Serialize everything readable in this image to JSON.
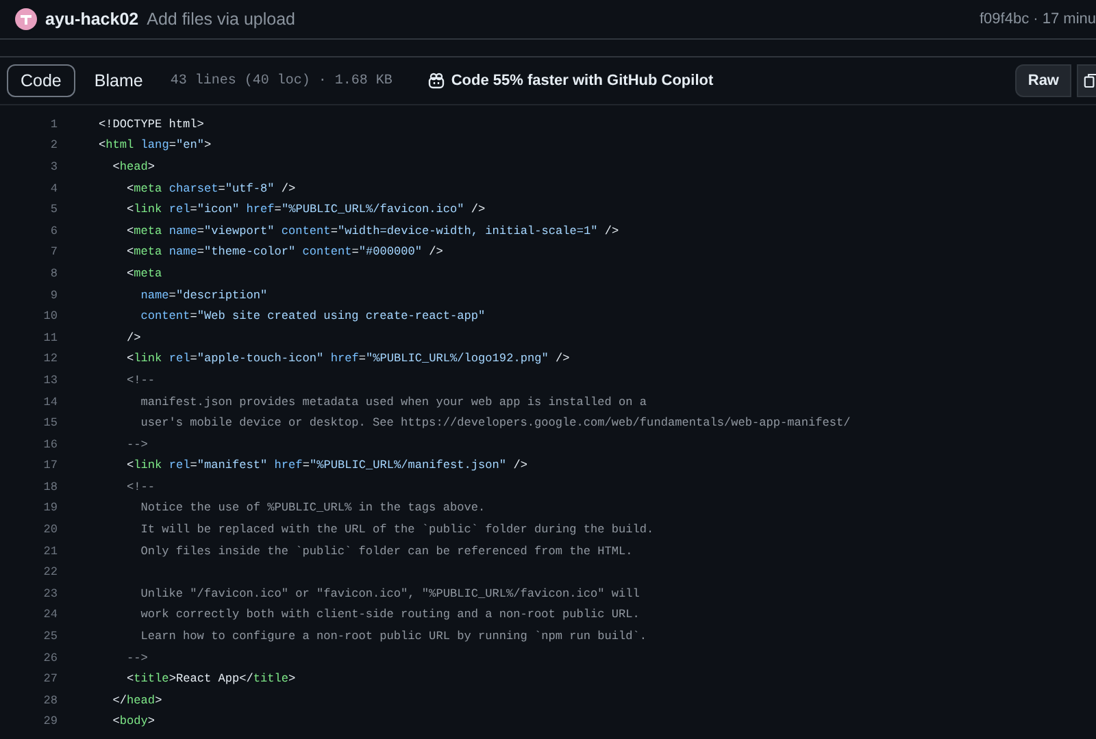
{
  "commit": {
    "author": "ayu-hack02",
    "message": "Add files via upload",
    "meta": "f09f4bc · 17 minu"
  },
  "toolbar": {
    "tabs": [
      {
        "label": "Code",
        "selected": true
      },
      {
        "label": "Blame",
        "selected": false
      }
    ],
    "file_info": "43 lines (40 loc) · 1.68 KB",
    "copilot": "Code 55% faster with GitHub Copilot",
    "raw": "Raw"
  },
  "lines": [
    {
      "number": "1",
      "tokens": [
        {
          "kind": "punct",
          "text": "<!DOCTYPE html>"
        }
      ]
    },
    {
      "number": "2",
      "tokens": [
        {
          "kind": "punct",
          "text": "<"
        },
        {
          "kind": "tag",
          "text": "html"
        },
        {
          "kind": "attr",
          "text": " lang"
        },
        {
          "kind": "punct",
          "text": "="
        },
        {
          "kind": "string",
          "text": "\"en\""
        },
        {
          "kind": "punct",
          "text": ">"
        }
      ]
    },
    {
      "number": "3",
      "tokens": [
        {
          "kind": "punct",
          "text": "  <"
        },
        {
          "kind": "tag",
          "text": "head"
        },
        {
          "kind": "punct",
          "text": ">"
        }
      ]
    },
    {
      "number": "4",
      "tokens": [
        {
          "kind": "punct",
          "text": "    <"
        },
        {
          "kind": "tag",
          "text": "meta"
        },
        {
          "kind": "attr",
          "text": " charset"
        },
        {
          "kind": "punct",
          "text": "="
        },
        {
          "kind": "string",
          "text": "\"utf-8\""
        },
        {
          "kind": "punct",
          "text": " />"
        }
      ]
    },
    {
      "number": "5",
      "tokens": [
        {
          "kind": "punct",
          "text": "    <"
        },
        {
          "kind": "tag",
          "text": "link"
        },
        {
          "kind": "attr",
          "text": " rel"
        },
        {
          "kind": "punct",
          "text": "="
        },
        {
          "kind": "string",
          "text": "\"icon\""
        },
        {
          "kind": "attr",
          "text": " href"
        },
        {
          "kind": "punct",
          "text": "="
        },
        {
          "kind": "string",
          "text": "\"%PUBLIC_URL%/favicon.ico\""
        },
        {
          "kind": "punct",
          "text": " />"
        }
      ]
    },
    {
      "number": "6",
      "tokens": [
        {
          "kind": "punct",
          "text": "    <"
        },
        {
          "kind": "tag",
          "text": "meta"
        },
        {
          "kind": "attr",
          "text": " name"
        },
        {
          "kind": "punct",
          "text": "="
        },
        {
          "kind": "string",
          "text": "\"viewport\""
        },
        {
          "kind": "attr",
          "text": " content"
        },
        {
          "kind": "punct",
          "text": "="
        },
        {
          "kind": "string",
          "text": "\"width=device-width, initial-scale=1\""
        },
        {
          "kind": "punct",
          "text": " />"
        }
      ]
    },
    {
      "number": "7",
      "tokens": [
        {
          "kind": "punct",
          "text": "    <"
        },
        {
          "kind": "tag",
          "text": "meta"
        },
        {
          "kind": "attr",
          "text": " name"
        },
        {
          "kind": "punct",
          "text": "="
        },
        {
          "kind": "string",
          "text": "\"theme-color\""
        },
        {
          "kind": "attr",
          "text": " content"
        },
        {
          "kind": "punct",
          "text": "="
        },
        {
          "kind": "string",
          "text": "\"#000000\""
        },
        {
          "kind": "punct",
          "text": " />"
        }
      ]
    },
    {
      "number": "8",
      "tokens": [
        {
          "kind": "punct",
          "text": "    <"
        },
        {
          "kind": "tag",
          "text": "meta"
        }
      ]
    },
    {
      "number": "9",
      "tokens": [
        {
          "kind": "attr",
          "text": "      name"
        },
        {
          "kind": "punct",
          "text": "="
        },
        {
          "kind": "string",
          "text": "\"description\""
        }
      ]
    },
    {
      "number": "10",
      "tokens": [
        {
          "kind": "attr",
          "text": "      content"
        },
        {
          "kind": "punct",
          "text": "="
        },
        {
          "kind": "string",
          "text": "\"Web site created using create-react-app\""
        }
      ]
    },
    {
      "number": "11",
      "tokens": [
        {
          "kind": "punct",
          "text": "    />"
        }
      ]
    },
    {
      "number": "12",
      "tokens": [
        {
          "kind": "punct",
          "text": "    <"
        },
        {
          "kind": "tag",
          "text": "link"
        },
        {
          "kind": "attr",
          "text": " rel"
        },
        {
          "kind": "punct",
          "text": "="
        },
        {
          "kind": "string",
          "text": "\"apple-touch-icon\""
        },
        {
          "kind": "attr",
          "text": " href"
        },
        {
          "kind": "punct",
          "text": "="
        },
        {
          "kind": "string",
          "text": "\"%PUBLIC_URL%/logo192.png\""
        },
        {
          "kind": "punct",
          "text": " />"
        }
      ]
    },
    {
      "number": "13",
      "tokens": [
        {
          "kind": "comment",
          "text": "    <!--"
        }
      ]
    },
    {
      "number": "14",
      "tokens": [
        {
          "kind": "comment",
          "text": "      manifest.json provides metadata used when your web app is installed on a"
        }
      ]
    },
    {
      "number": "15",
      "tokens": [
        {
          "kind": "comment",
          "text": "      user's mobile device or desktop. See https://developers.google.com/web/fundamentals/web-app-manifest/"
        }
      ]
    },
    {
      "number": "16",
      "tokens": [
        {
          "kind": "comment",
          "text": "    -->"
        }
      ]
    },
    {
      "number": "17",
      "tokens": [
        {
          "kind": "punct",
          "text": "    <"
        },
        {
          "kind": "tag",
          "text": "link"
        },
        {
          "kind": "attr",
          "text": " rel"
        },
        {
          "kind": "punct",
          "text": "="
        },
        {
          "kind": "string",
          "text": "\"manifest\""
        },
        {
          "kind": "attr",
          "text": " href"
        },
        {
          "kind": "punct",
          "text": "="
        },
        {
          "kind": "string",
          "text": "\"%PUBLIC_URL%/manifest.json\""
        },
        {
          "kind": "punct",
          "text": " />"
        }
      ]
    },
    {
      "number": "18",
      "tokens": [
        {
          "kind": "comment",
          "text": "    <!--"
        }
      ]
    },
    {
      "number": "19",
      "tokens": [
        {
          "kind": "comment",
          "text": "      Notice the use of %PUBLIC_URL% in the tags above."
        }
      ]
    },
    {
      "number": "20",
      "tokens": [
        {
          "kind": "comment",
          "text": "      It will be replaced with the URL of the `public` folder during the build."
        }
      ]
    },
    {
      "number": "21",
      "tokens": [
        {
          "kind": "comment",
          "text": "      Only files inside the `public` folder can be referenced from the HTML."
        }
      ]
    },
    {
      "number": "22"
    },
    {
      "number": "23",
      "tokens": [
        {
          "kind": "comment",
          "text": "      Unlike \"/favicon.ico\" or \"favicon.ico\", \"%PUBLIC_URL%/favicon.ico\" will"
        }
      ]
    },
    {
      "number": "24",
      "tokens": [
        {
          "kind": "comment",
          "text": "      work correctly both with client-side routing and a non-root public URL."
        }
      ]
    },
    {
      "number": "25",
      "tokens": [
        {
          "kind": "comment",
          "text": "      Learn how to configure a non-root public URL by running `npm run build`."
        }
      ]
    },
    {
      "number": "26",
      "tokens": [
        {
          "kind": "comment",
          "text": "    -->"
        }
      ]
    },
    {
      "number": "27",
      "tokens": [
        {
          "kind": "punct",
          "text": "    <"
        },
        {
          "kind": "tag",
          "text": "title"
        },
        {
          "kind": "punct",
          "text": ">"
        },
        {
          "kind": "text",
          "text": "React App"
        },
        {
          "kind": "punct",
          "text": "</"
        },
        {
          "kind": "tag",
          "text": "title"
        },
        {
          "kind": "punct",
          "text": ">"
        }
      ]
    },
    {
      "number": "28",
      "tokens": [
        {
          "kind": "punct",
          "text": "  </"
        },
        {
          "kind": "tag",
          "text": "head"
        },
        {
          "kind": "punct",
          "text": ">"
        }
      ]
    },
    {
      "number": "29",
      "tokens": [
        {
          "kind": "punct",
          "text": "  <"
        },
        {
          "kind": "tag",
          "text": "body"
        },
        {
          "kind": "punct",
          "text": ">"
        }
      ]
    }
  ]
}
